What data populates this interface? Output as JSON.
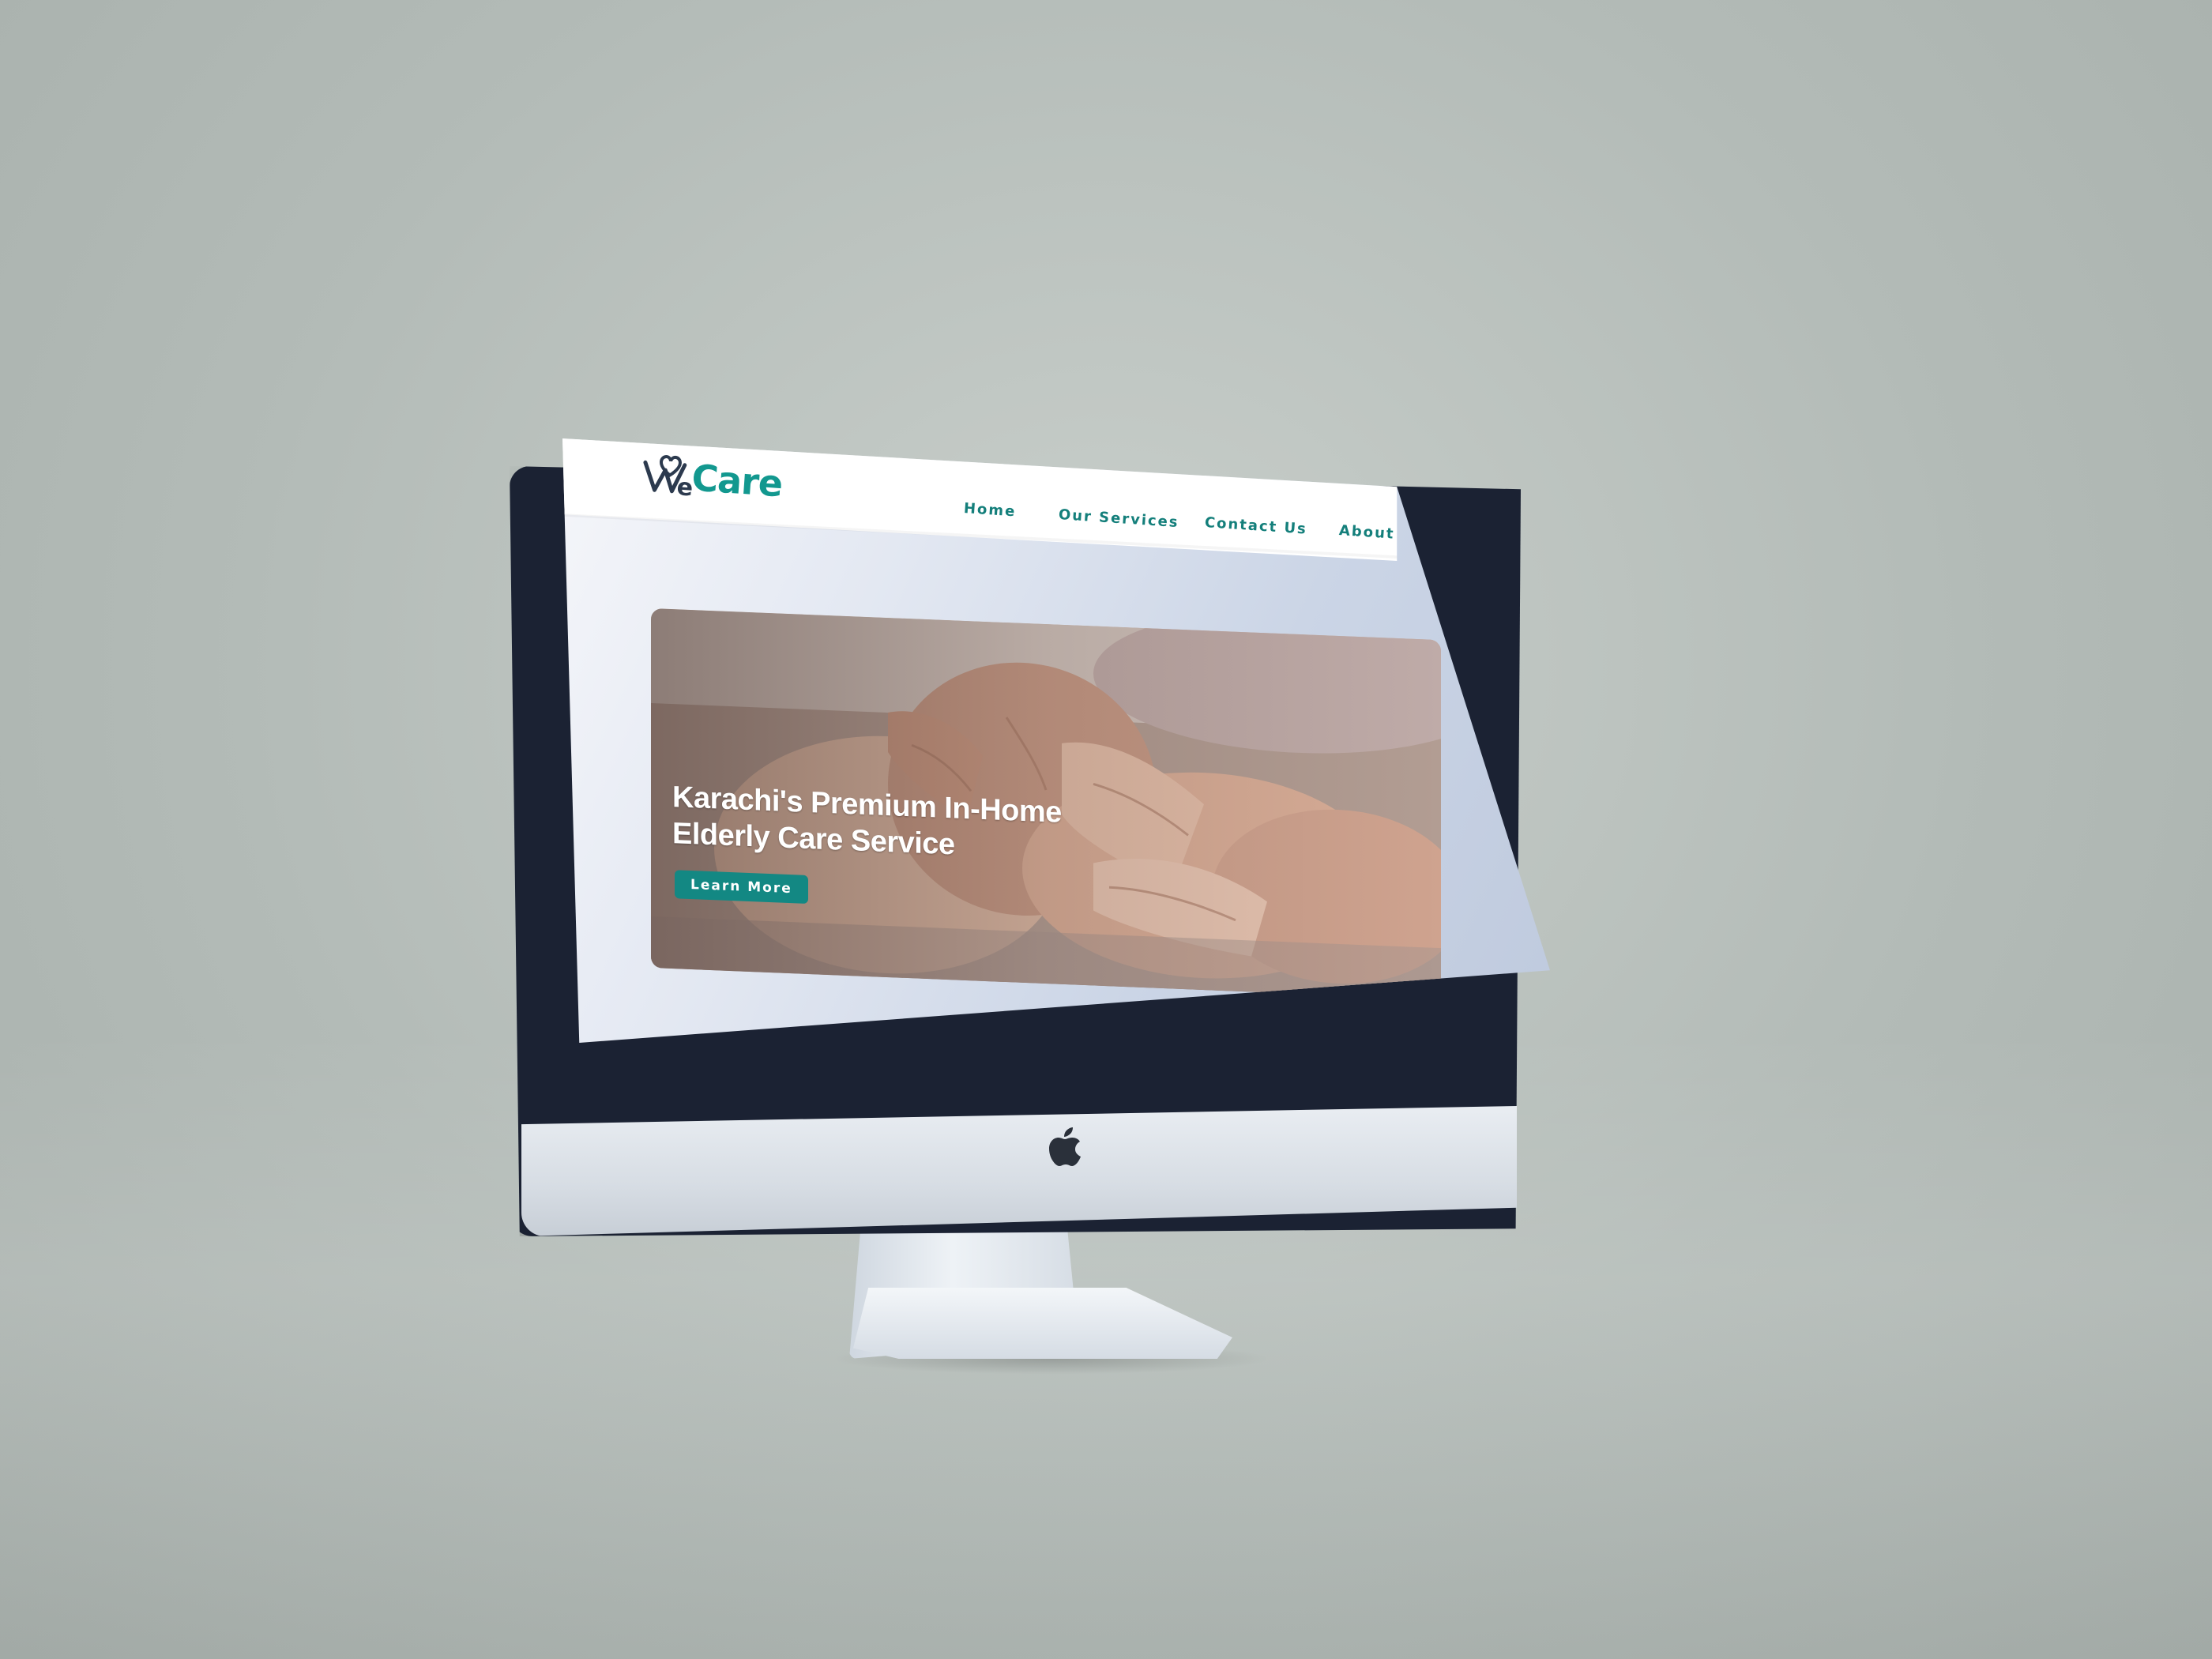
{
  "brand": {
    "logo_prefix": "W",
    "logo_main": "e",
    "logo_care": "Care",
    "logo_dark": "#2c3a4e",
    "logo_teal": "#12988f"
  },
  "nav": {
    "items": [
      {
        "label": "Home"
      },
      {
        "label": "Our Services"
      },
      {
        "label": "Contact Us"
      },
      {
        "label": "About"
      }
    ],
    "color": "#147f7b"
  },
  "hero": {
    "title": "Karachi's Premium In-Home Elderly Care Service",
    "cta_label": "Learn More",
    "cta_color": "#138883"
  },
  "device": {
    "apple_logo": "apple-icon"
  }
}
